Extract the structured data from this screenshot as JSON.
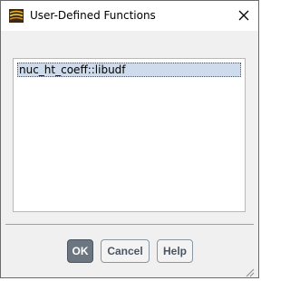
{
  "window": {
    "title": "User-Defined Functions",
    "icon": "fluent-app-icon",
    "close_icon": "close-icon"
  },
  "functions_list": {
    "items": [
      {
        "label": "nuc_ht_coeff::libudf",
        "selected": true
      }
    ]
  },
  "buttons": {
    "ok_label": "OK",
    "cancel_label": "Cancel",
    "help_label": "Help"
  },
  "colors": {
    "selection": "#cddbec",
    "primary_button": "#6b7680"
  }
}
